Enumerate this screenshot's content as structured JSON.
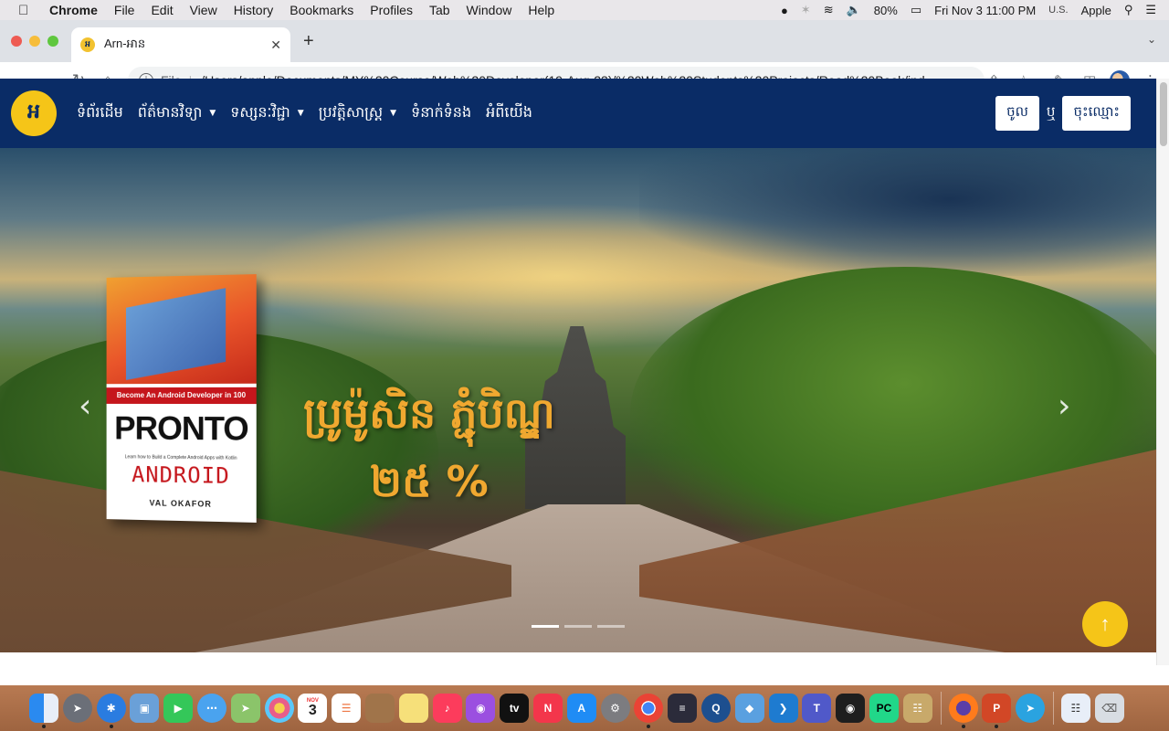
{
  "menubar": {
    "app": "Chrome",
    "items": [
      "File",
      "Edit",
      "View",
      "History",
      "Bookmarks",
      "Profiles",
      "Tab",
      "Window",
      "Help"
    ],
    "battery": "80%",
    "datetime": "Fri Nov 3  11:00 PM",
    "input_source": "U.S.",
    "user": "Apple"
  },
  "browser": {
    "tab_title": "Arn-អាន",
    "favicon_text": "អ",
    "scheme": "File",
    "url": "/Users/apple/Documents/MY%20Course/Web%20Developer(19-Aug-23)/%20Web%20Students%20Projects/Read%20Book/ind..."
  },
  "site": {
    "logo_text": "អ",
    "nav": [
      {
        "label": "ទំព័រដើម",
        "dropdown": false
      },
      {
        "label": "ព័ត៌មានវិទ្យា",
        "dropdown": true
      },
      {
        "label": "ទស្សនៈវិជ្ជា",
        "dropdown": true
      },
      {
        "label": "ប្រវត្តិសាស្ត្រ",
        "dropdown": true
      },
      {
        "label": "ទំនាក់ទំនង",
        "dropdown": false
      },
      {
        "label": "អំពីយើង",
        "dropdown": false
      }
    ],
    "login_label": "ចូល",
    "or_label": "ឬ",
    "register_label": "ចុះឈ្មោះ"
  },
  "hero": {
    "book": {
      "banner": "Become An Android Developer in 100 Days!",
      "title": "PRONTO",
      "subtitle": "Learn how to Build a Complete Android Apps with Kotlin",
      "android": "ANDROID",
      "author": "VAL OKAFOR"
    },
    "promo_line1": "ប្រូម៉ូសិន ភ្ជុំបិណ្ឌ",
    "promo_line2": "២៥ %",
    "prev_icon": "chevron-left-icon",
    "next_icon": "chevron-right-icon",
    "slide_count": 3,
    "active_slide": 1
  },
  "colors": {
    "navbar": "#0a2c66",
    "accent": "#f5c518",
    "promo_text": "#f0a830"
  },
  "dock": {
    "apps": [
      "finder",
      "launchpad",
      "safari",
      "preview",
      "facetime",
      "messages",
      "maps",
      "photos",
      "calendar",
      "reminders",
      "notes",
      "stickies",
      "music",
      "podcasts",
      "tv",
      "news",
      "app-store",
      "system-preferences",
      "chrome",
      "sublime",
      "quicktime",
      "virtualbox",
      "vscode",
      "teams",
      "figma",
      "pycharm",
      "archive",
      "firefox",
      "powerpoint",
      "telegram",
      "documents",
      "trash"
    ],
    "calendar_month": "NOV",
    "calendar_day": "3"
  }
}
